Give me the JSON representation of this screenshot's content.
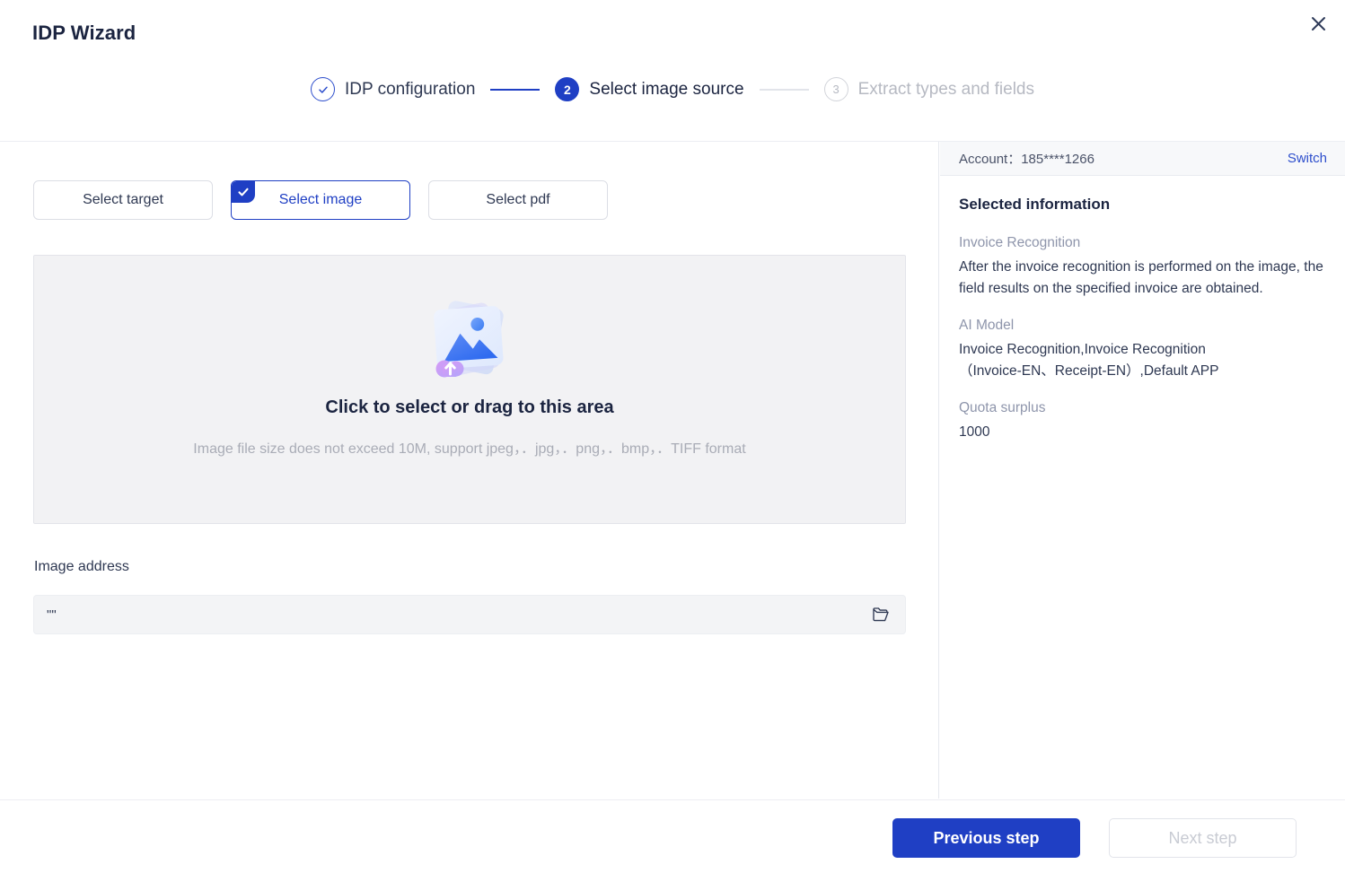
{
  "window": {
    "title": "IDP Wizard",
    "close_icon": "close-icon"
  },
  "stepper": {
    "steps": [
      {
        "indicator": "✓",
        "label": "IDP configuration",
        "state": "done"
      },
      {
        "indicator": "2",
        "label": "Select image source",
        "state": "active"
      },
      {
        "indicator": "3",
        "label": "Extract types and fields",
        "state": "todo"
      }
    ],
    "accent_color": "#1f3fc4",
    "inactive_color": "#b6b9c2"
  },
  "source_tabs": [
    {
      "label": "Select target",
      "selected": false
    },
    {
      "label": "Select image",
      "selected": true
    },
    {
      "label": "Select pdf",
      "selected": false
    }
  ],
  "dropzone": {
    "icon": "image-upload-icon",
    "title": "Click to select or drag to this area",
    "hint": "Image file size does not exceed 10M, support jpeg，．jpg，．png，．bmp，．TIFF format"
  },
  "image_address": {
    "label": "Image address",
    "value": "\"\"",
    "placeholder": "",
    "browse_icon": "folder-icon"
  },
  "sidebar": {
    "account_label": "Account：185****1266",
    "switch_label": "Switch",
    "heading": "Selected information",
    "fields": [
      {
        "key": "Invoice Recognition",
        "value": "After the invoice recognition is performed on the image, the field results on the specified invoice are obtained."
      },
      {
        "key": "AI Model",
        "value": "Invoice Recognition,Invoice Recognition\n（Invoice-EN、Receipt-EN）,Default APP"
      },
      {
        "key": "Quota surplus",
        "value": "1000"
      }
    ]
  },
  "footer": {
    "previous_label": "Previous step",
    "next_label": "Next step",
    "next_disabled": true
  }
}
